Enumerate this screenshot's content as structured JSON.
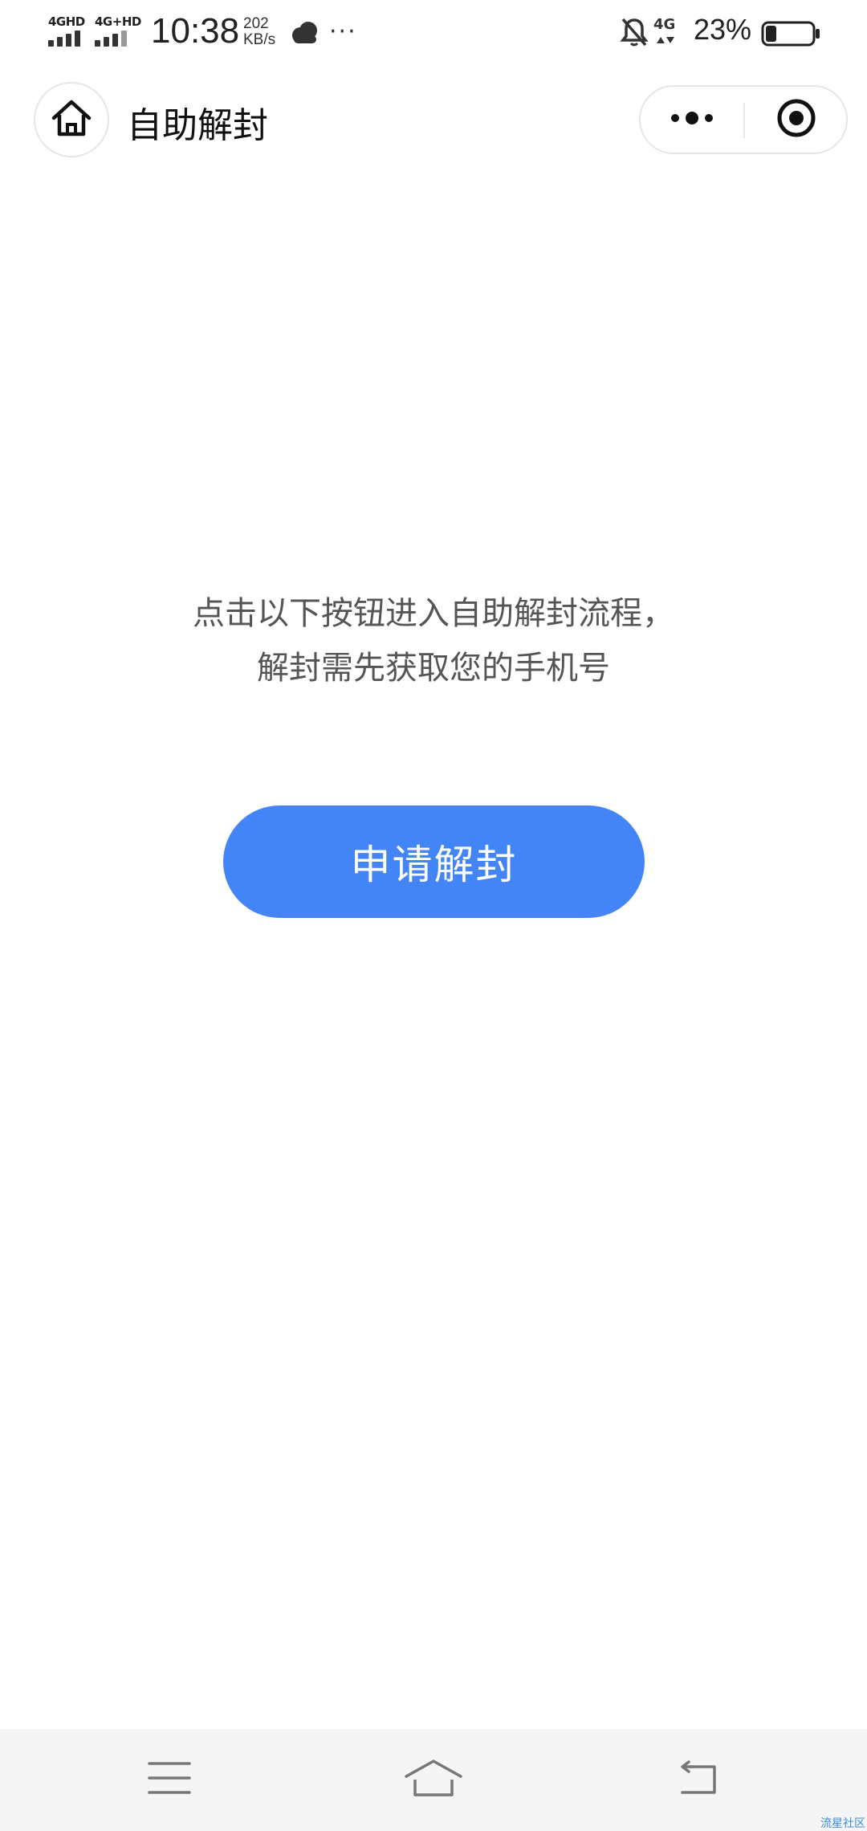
{
  "status_bar": {
    "signal_1_label": "4GHD",
    "signal_2_label": "4G+HD",
    "time": "10:38",
    "speed_value": "202",
    "speed_unit": "KB/s",
    "more": "···",
    "network_label": "4G",
    "battery_percent": "23%",
    "battery_level": 0.23,
    "icons": [
      "weather-cloud-icon",
      "bell-off-icon",
      "battery-icon"
    ]
  },
  "title_bar": {
    "title": "自助解封",
    "icons": [
      "home-icon",
      "more-dots-icon",
      "close-target-icon"
    ]
  },
  "main": {
    "instruction_line_1": "点击以下按钮进入自助解封流程，",
    "instruction_line_2": "解封需先获取您的手机号",
    "apply_button_label": "申请解封"
  },
  "nav_bar": {
    "icons": [
      "menu-icon",
      "home-outline-icon",
      "back-icon"
    ]
  },
  "watermark": "流星社区",
  "colors": {
    "accent": "#4384f7",
    "text_secondary": "#555555",
    "nav_background": "#f5f5f5"
  }
}
